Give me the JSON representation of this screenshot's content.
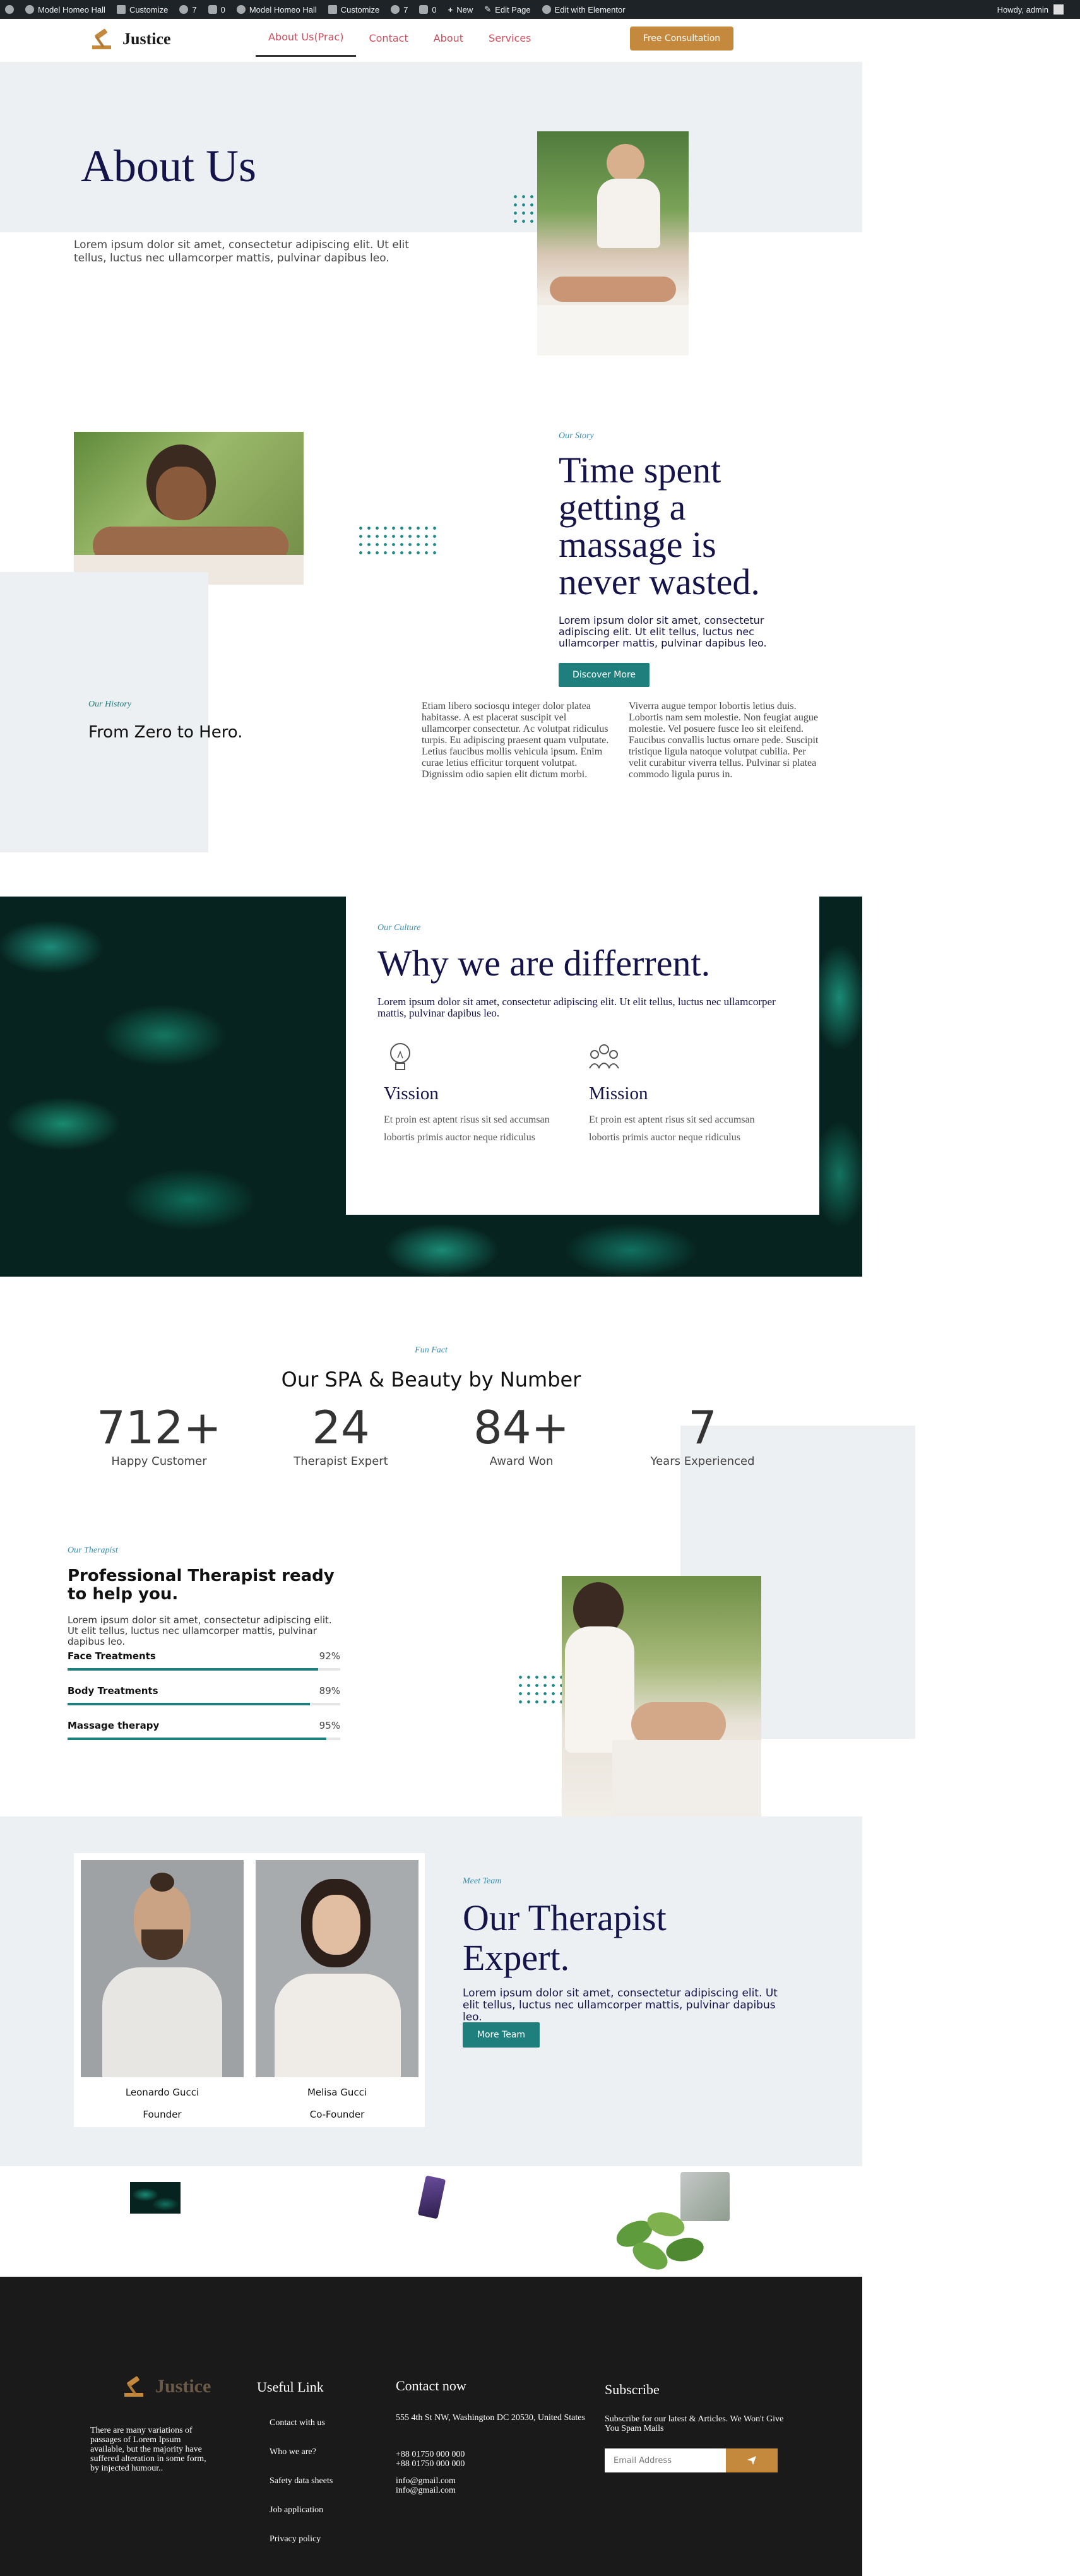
{
  "admin_bar": {
    "site_name_1": "Model Homeo Hall",
    "customize_1": "Customize",
    "updates_1": "7",
    "comments_1": "0",
    "site_name_2": "Model Homeo Hall",
    "customize_2": "Customize",
    "updates_2": "7",
    "comments_2": "0",
    "new": "New",
    "edit_page": "Edit Page",
    "edit_elementor": "Edit with Elementor",
    "howdy": "Howdy, admin"
  },
  "header": {
    "logo_text": "Justice",
    "nav": [
      "About Us(Prac)",
      "Contact",
      "About",
      "Services"
    ],
    "cta": "Free Consultation"
  },
  "hero": {
    "title": "About Us",
    "text": "Lorem ipsum dolor sit amet, consectetur adipiscing elit. Ut elit tellus, luctus nec ullamcorper mattis, pulvinar dapibus leo."
  },
  "story": {
    "kicker": "Our Story",
    "title": "Time spent getting a massage is never wasted.",
    "text": "Lorem ipsum dolor sit amet, consectetur adipiscing elit. Ut elit tellus, luctus nec ullamcorper mattis, pulvinar dapibus leo.",
    "button": "Discover More"
  },
  "history": {
    "kicker": "Our History",
    "title": "From Zero to Hero.",
    "col1": "Etiam libero sociosqu integer dolor platea habitasse. A est placerat suscipit vel ullamcorper consectetur. Ac volutpat ridiculus turpis. Eu adipiscing praesent quam vulputate. Letius faucibus mollis vehicula ipsum. Enim curae letius efficitur torquent volutpat. Dignissim odio sapien elit dictum morbi.",
    "col2": "Viverra augue tempor lobortis letius duis. Lobortis nam sem molestie. Non feugiat augue molestie. Vel posuere fusce leo sit eleifend. Faucibus convallis luctus ornare pede. Suscipit tristique ligula natoque volutpat cubilia. Per velit curabitur viverra tellus. Pulvinar si platea commodo ligula purus in."
  },
  "culture": {
    "kicker": "Our Culture",
    "title": "Why we are differrent.",
    "text": "Lorem ipsum dolor sit amet, consectetur adipiscing elit. Ut elit tellus, luctus nec ullamcorper mattis, pulvinar dapibus leo.",
    "vision_title": "Vission",
    "vision_text": "Et proin est aptent risus sit sed accumsan lobortis primis auctor neque ridiculus",
    "mission_title": "Mission",
    "mission_text": "Et proin est aptent risus sit sed accumsan lobortis primis auctor neque ridiculus"
  },
  "funfact": {
    "kicker": "Fun Fact",
    "title": "Our SPA & Beauty by Number",
    "stats": [
      {
        "number": "712+",
        "label": "Happy Customer"
      },
      {
        "number": "24",
        "label": "Therapist Expert"
      },
      {
        "number": "84+",
        "label": "Award Won"
      },
      {
        "number": "7",
        "label": "Years Experienced"
      }
    ]
  },
  "therapist": {
    "kicker": "Our Therapist",
    "title": "Professional Therapist ready to help you.",
    "text": "Lorem ipsum dolor sit amet, consectetur adipiscing elit. Ut elit tellus, luctus nec ullamcorper mattis, pulvinar dapibus leo.",
    "skills": [
      {
        "name": "Face Treatments",
        "percent_label": "92%",
        "value": 92
      },
      {
        "name": "Body Treatments",
        "percent_label": "89%",
        "value": 89
      },
      {
        "name": "Massage therapy",
        "percent_label": "95%",
        "value": 95
      }
    ]
  },
  "team": {
    "kicker": "Meet Team",
    "title": "Our Therapist Expert.",
    "text": "Lorem ipsum dolor sit amet, consectetur adipiscing elit. Ut elit tellus, luctus nec ullamcorper mattis, pulvinar dapibus leo.",
    "button": "More Team",
    "members": [
      {
        "name": "Leonardo Gucci",
        "role": "Founder"
      },
      {
        "name": "Melisa Gucci",
        "role": "Co-Founder"
      }
    ]
  },
  "footer": {
    "logo_text": "Justice",
    "about": "There are many variations of passages of Lorem Ipsum available, but the majority have suffered alteration in some form, by injected humour..",
    "useful_title": "Useful Link",
    "links": [
      "Contact with us",
      "Who we are?",
      "Safety data sheets",
      "Job application",
      "Privacy policy"
    ],
    "contact_title": "Contact now",
    "address": "555 4th St NW, Washington DC 20530, United States",
    "phone1": "+88 01750 000 000",
    "phone2": "+88 01750 000 000",
    "email1": "info@gmail.com",
    "email2": "info@gmail.com",
    "subscribe_title": "Subscribe",
    "subscribe_text": "Subscribe for our latest & Articles. We Won't Give You Spam Mails",
    "email_placeholder": "Email Address"
  },
  "colors": {
    "navy": "#14144a",
    "teal": "#1f7f7d",
    "gold": "#c4893d",
    "nav_pink": "#d04a5b",
    "light_grey": "#edf0f2",
    "footer_bg": "#1a1a1a"
  }
}
